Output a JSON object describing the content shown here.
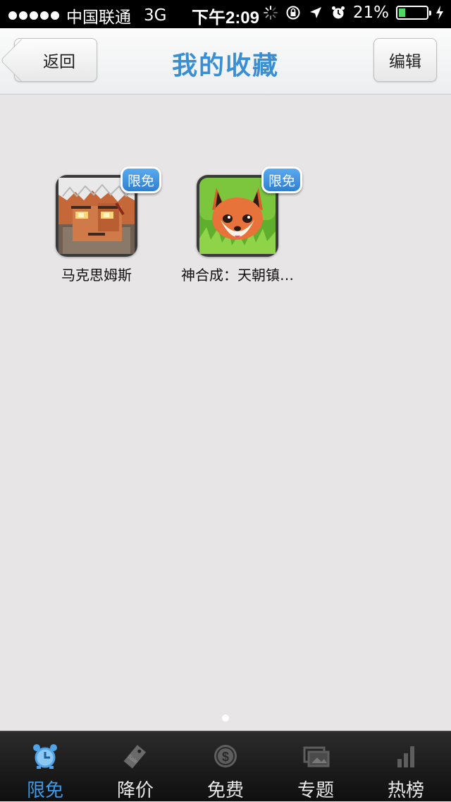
{
  "status_bar": {
    "carrier": "中国联通",
    "network": "3G",
    "time": "下午2:09",
    "battery": "21%",
    "battery_level": 0.21
  },
  "nav": {
    "back_label": "返回",
    "title": "我的收藏",
    "edit_label": "编辑"
  },
  "apps": [
    {
      "name": "马克思姆斯",
      "badge": "限免",
      "icon": "warrior-face-icon"
    },
    {
      "name": "神合成：天朝镇…",
      "badge": "限免",
      "icon": "fox-icon"
    }
  ],
  "pager": {
    "pages": 1,
    "current": 1
  },
  "tabs": [
    {
      "label": "限免",
      "icon": "alarm-clock-icon",
      "active": true
    },
    {
      "label": "降价",
      "icon": "sale-tag-icon",
      "active": false
    },
    {
      "label": "免费",
      "icon": "dollar-coin-icon",
      "active": false
    },
    {
      "label": "专题",
      "icon": "topics-icon",
      "active": false
    },
    {
      "label": "热榜",
      "icon": "bar-chart-icon",
      "active": false
    }
  ],
  "colors": {
    "accent": "#3a8ed4",
    "badge": "#3f8fdf",
    "background": "#e7e5e6",
    "battery": "#4cd964"
  }
}
